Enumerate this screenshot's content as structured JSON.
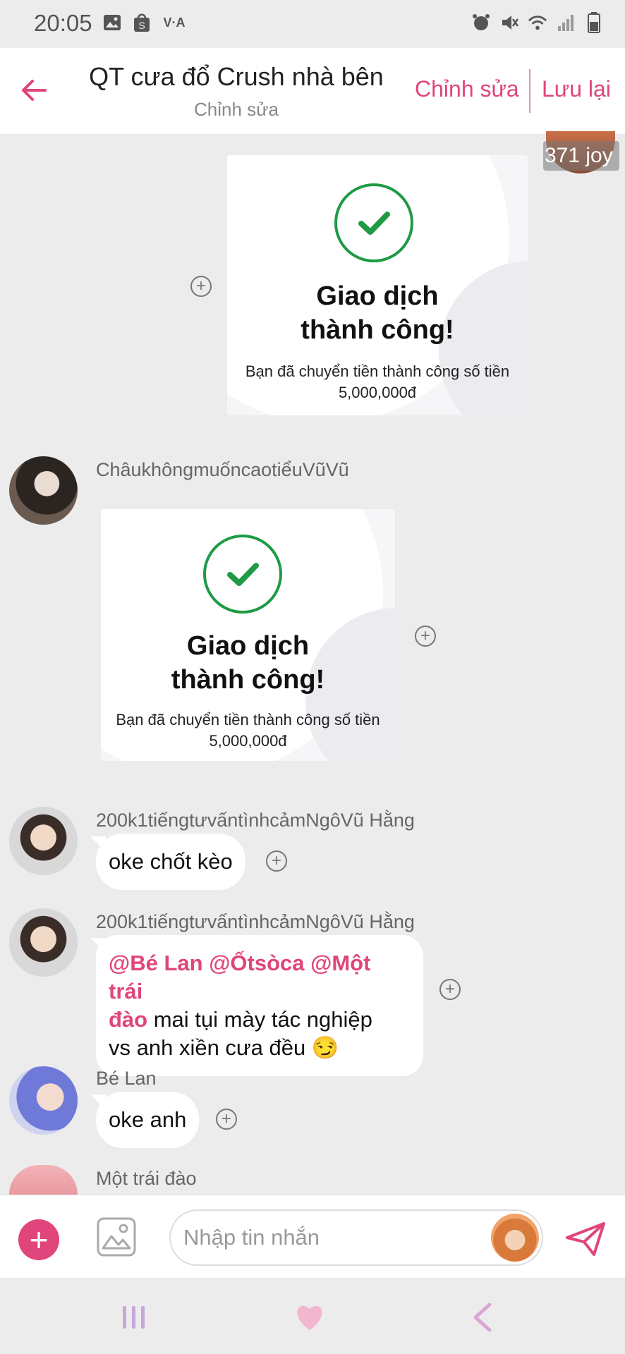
{
  "status_bar": {
    "time": "20:05",
    "left_icons": [
      "image-icon",
      "shopee-icon",
      "vna-icon"
    ],
    "right_icons": [
      "alarm-icon",
      "mute-icon",
      "wifi-icon",
      "signal-icon",
      "battery-icon"
    ],
    "vna_text": "V·A"
  },
  "header": {
    "title": "QT cưa đổ Crush nhà bên",
    "subtitle": "Chỉnh sửa",
    "edit_label": "Chỉnh sửa",
    "save_label": "Lưu lại",
    "accent": "#e0457b"
  },
  "messages": [
    {
      "type": "receipt",
      "side": "right",
      "avatar_overlay": "371 joy",
      "receipt_title_line1": "Giao dịch",
      "receipt_title_line2": "thành công!",
      "receipt_desc": "Bạn đã chuyển tiền thành công số tiền",
      "receipt_amount": "5,000,000đ"
    },
    {
      "type": "receipt",
      "side": "left",
      "sender": "ChâukhôngmuốncaotiểuVũVũ",
      "receipt_title_line1": "Giao dịch",
      "receipt_title_line2": "thành công!",
      "receipt_desc": "Bạn đã chuyển tiền thành công số tiền",
      "receipt_amount": "5,000,000đ"
    },
    {
      "type": "text",
      "sender": "200k1tiếngtưvấntìnhcảmNgôVũ Hằng",
      "text": "oke chốt kèo"
    },
    {
      "type": "text",
      "sender": "200k1tiếngtưvấntìnhcảmNgôVũ Hằng",
      "mention_line1": "@Bé Lan @Ốtsòca @Một trái",
      "mention_line2": "đào",
      "text_line2_rest": " mai tụi mày tác nghiệp",
      "text_line3": "vs anh xiền cưa đều 😏"
    },
    {
      "type": "text",
      "sender": "Bé Lan",
      "text": "oke anh"
    },
    {
      "type": "text",
      "sender": "Một trái đào",
      "text": ""
    }
  ],
  "input_bar": {
    "placeholder": "Nhập tin nhắn"
  },
  "nav_bar": {
    "icons": [
      "recent-apps-icon",
      "home-heart-icon",
      "back-nav-icon"
    ]
  }
}
